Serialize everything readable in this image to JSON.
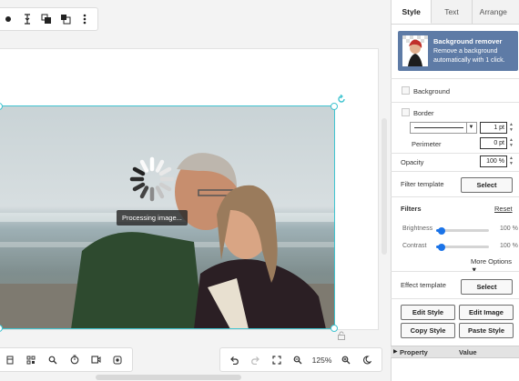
{
  "canvas": {
    "processing_text": "Processing image...",
    "zoom_label": "125%"
  },
  "icons": {
    "top_toolbar": [
      "fill-icon",
      "align-icon",
      "bring-forward-icon",
      "send-backward-icon",
      "more-icon"
    ],
    "bottom_left_toolbar": [
      "pages-icon",
      "grid-icon",
      "search-icon",
      "timer-icon",
      "video-icon",
      "record-icon"
    ],
    "bottom_right_toolbar": [
      "undo-icon",
      "redo-icon",
      "fullscreen-icon",
      "zoom-out-icon",
      "zoom-in-icon",
      "dark-mode-icon"
    ]
  },
  "panel": {
    "tabs": [
      "Style",
      "Text",
      "Arrange"
    ],
    "active_tab": "Style",
    "promo": {
      "title": "Background remover",
      "subtitle": "Remove a background automatically with 1 click."
    },
    "background_label": "Background",
    "border_label": "Border",
    "border_width": "1 pt",
    "perimeter_label": "Perimeter",
    "perimeter_value": "0 pt",
    "opacity_label": "Opacity",
    "opacity_value": "100 %",
    "filter_template_label": "Filter template",
    "select_label": "Select",
    "filters_label": "Filters",
    "reset_label": "Reset",
    "brightness_label": "Brightness",
    "brightness_value": "100 %",
    "brightness_level": 0.1,
    "contrast_label": "Contrast",
    "contrast_value": "100 %",
    "contrast_level": 0.1,
    "more_options_label": "More Options ▼",
    "effect_template_label": "Effect template",
    "effect_select_label": "Select",
    "edit_style_label": "Edit Style",
    "edit_image_label": "Edit Image",
    "copy_style_label": "Copy Style",
    "paste_style_label": "Paste Style",
    "property_header": "Property",
    "value_header": "Value"
  },
  "colors": {
    "selection": "#40c4d0",
    "accent": "#1a73e8",
    "promo_bg": "#5e7ba6"
  }
}
